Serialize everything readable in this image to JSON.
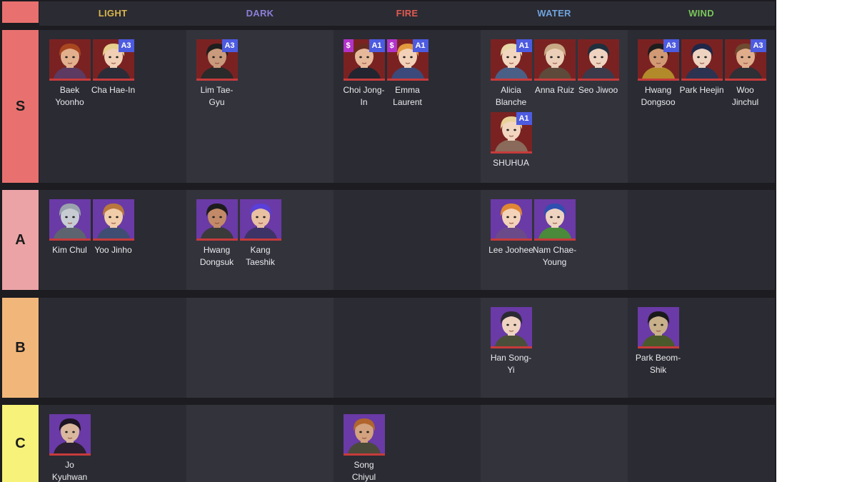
{
  "columns": [
    {
      "label": "LIGHT",
      "color": "#d9b64c"
    },
    {
      "label": "DARK",
      "color": "#8b7fd8"
    },
    {
      "label": "FIRE",
      "color": "#e05b52"
    },
    {
      "label": "WATER",
      "color": "#6fa3dc"
    },
    {
      "label": "WIND",
      "color": "#79c75a"
    }
  ],
  "tiers": [
    {
      "label": "S",
      "color": "#e8716f",
      "cells": [
        [
          {
            "name": "Baek Yoonho",
            "badge": "",
            "cost": "",
            "icon": "portrait-red-hair",
            "palette": {
              "bg": "#7a2222",
              "hair": "#a8461f",
              "skin": "#e3b08e",
              "cloth": "#5c3a62"
            }
          },
          {
            "name": "Cha Hae-In",
            "badge": "A3",
            "cost": "",
            "icon": "portrait-blonde",
            "palette": {
              "bg": "#7a2222",
              "hair": "#e6cf8c",
              "skin": "#f0cfb5",
              "cloth": "#2c2c38"
            }
          }
        ],
        [
          {
            "name": "Lim Tae-Gyu",
            "badge": "A3",
            "cost": "",
            "icon": "portrait-cowboy",
            "palette": {
              "bg": "#7a2222",
              "hair": "#1e1e1e",
              "skin": "#c99a7c",
              "cloth": "#2a2a2a"
            }
          }
        ],
        [
          {
            "name": "Choi Jong-In",
            "badge": "A1",
            "cost": "$",
            "icon": "portrait-glasses",
            "palette": {
              "bg": "#7a2222",
              "hair": "#6a2b1f",
              "skin": "#e6b99a",
              "cloth": "#222530"
            }
          },
          {
            "name": "Emma Laurent",
            "badge": "A1",
            "cost": "$",
            "icon": "portrait-orange-hair",
            "palette": {
              "bg": "#7a2222",
              "hair": "#e39a3e",
              "skin": "#f2d1b8",
              "cloth": "#3b4a7a"
            }
          }
        ],
        [
          {
            "name": "Alicia Blanche",
            "badge": "A1",
            "cost": "",
            "icon": "portrait-blonde-long",
            "palette": {
              "bg": "#7a2222",
              "hair": "#e8d8a8",
              "skin": "#f2d6c0",
              "cloth": "#4a5f86"
            }
          },
          {
            "name": "Anna Ruiz",
            "badge": "",
            "cost": "",
            "icon": "portrait-light-brown",
            "palette": {
              "bg": "#7a2222",
              "hair": "#c8a985",
              "skin": "#eccfb8",
              "cloth": "#5d4a3a"
            }
          },
          {
            "name": "Seo Jiwoo",
            "badge": "",
            "cost": "",
            "icon": "portrait-dark-bob",
            "palette": {
              "bg": "#7a2222",
              "hair": "#1f2f3d",
              "skin": "#eed3c1",
              "cloth": "#3a3a4a"
            }
          },
          {
            "name": "SHUHUA",
            "badge": "A1",
            "cost": "",
            "icon": "portrait-blonde-idol",
            "palette": {
              "bg": "#7a2222",
              "hair": "#e8d29a",
              "skin": "#f2d6c0",
              "cloth": "#8a6a5a"
            }
          }
        ],
        [
          {
            "name": "Hwang Dongsoo",
            "badge": "A3",
            "cost": "",
            "icon": "portrait-sunglasses",
            "palette": {
              "bg": "#7a2222",
              "hair": "#1d1d1d",
              "skin": "#d19a74",
              "cloth": "#b38a2a"
            }
          },
          {
            "name": "Park Heejin",
            "badge": "",
            "cost": "",
            "icon": "portrait-navy-hair",
            "palette": {
              "bg": "#7a2222",
              "hair": "#1f2748",
              "skin": "#eed3c1",
              "cloth": "#2c3350"
            }
          },
          {
            "name": "Woo Jinchul",
            "badge": "A3",
            "cost": "",
            "icon": "portrait-slicked-hair",
            "palette": {
              "bg": "#7a2222",
              "hair": "#6e4a30",
              "skin": "#e0ad8c",
              "cloth": "#2f2f36"
            }
          }
        ]
      ]
    },
    {
      "label": "A",
      "color": "#eba3a6",
      "cells": [
        [
          {
            "name": "Kim Chul",
            "badge": "",
            "cost": "",
            "icon": "portrait-armored",
            "palette": {
              "bg": "#6a3aa6",
              "hair": "#9aa3ad",
              "skin": "#c7ccd2",
              "cloth": "#5d6470"
            }
          },
          {
            "name": "Yoo Jinho",
            "badge": "",
            "cost": "",
            "icon": "portrait-brown-hair",
            "palette": {
              "bg": "#6a3aa6",
              "hair": "#b8773d",
              "skin": "#f1cda9",
              "cloth": "#3f4d72"
            }
          }
        ],
        [
          {
            "name": "Hwang Dongsuk",
            "badge": "",
            "cost": "",
            "icon": "portrait-bearded",
            "palette": {
              "bg": "#6a3aa6",
              "hair": "#1c1c1c",
              "skin": "#c28a68",
              "cloth": "#3a3a3a"
            }
          },
          {
            "name": "Kang Taeshik",
            "badge": "",
            "cost": "",
            "icon": "portrait-purple-hair",
            "palette": {
              "bg": "#6a3aa6",
              "hair": "#5a3fd8",
              "skin": "#e8c0a2",
              "cloth": "#3e3366"
            }
          }
        ],
        [],
        [
          {
            "name": "Lee Joohee",
            "badge": "",
            "cost": "",
            "icon": "portrait-orange-long",
            "palette": {
              "bg": "#6a3aa6",
              "hair": "#e08734",
              "skin": "#f3d3b9",
              "cloth": "#6b4a8a"
            }
          },
          {
            "name": "Nam Chae-Young",
            "badge": "",
            "cost": "",
            "icon": "portrait-blue-hood",
            "palette": {
              "bg": "#6a3aa6",
              "hair": "#2f4fb0",
              "skin": "#eed3c1",
              "cloth": "#4a8a3a"
            }
          }
        ],
        []
      ]
    },
    {
      "label": "B",
      "color": "#f1b77a",
      "cells": [
        [],
        [],
        [],
        [
          {
            "name": "Han Song-Yi",
            "badge": "",
            "cost": "",
            "icon": "portrait-headphones",
            "palette": {
              "bg": "#6a3aa6",
              "hair": "#2a2a34",
              "skin": "#eed3c1",
              "cloth": "#4a4f3a"
            }
          }
        ],
        [
          {
            "name": "Park Beom-Shik",
            "badge": "",
            "cost": "",
            "icon": "portrait-military",
            "palette": {
              "bg": "#6a3aa6",
              "hair": "#1a1a1a",
              "skin": "#c8b08a",
              "cloth": "#4a5a2a"
            }
          }
        ]
      ]
    },
    {
      "label": "C",
      "color": "#f6f27a",
      "cells": [
        [
          {
            "name": "Jo Kyuhwan",
            "badge": "",
            "cost": "",
            "icon": "portrait-long-dark-hair",
            "palette": {
              "bg": "#6a3aa6",
              "hair": "#1c1420",
              "skin": "#d9b89e",
              "cloth": "#2a2030"
            }
          }
        ],
        [],
        [
          {
            "name": "Song Chiyul",
            "badge": "",
            "cost": "",
            "icon": "portrait-stubble",
            "palette": {
              "bg": "#6a3aa6",
              "hair": "#b0652c",
              "skin": "#d3a27e",
              "cloth": "#4a4a3a"
            }
          }
        ],
        [],
        []
      ]
    }
  ]
}
